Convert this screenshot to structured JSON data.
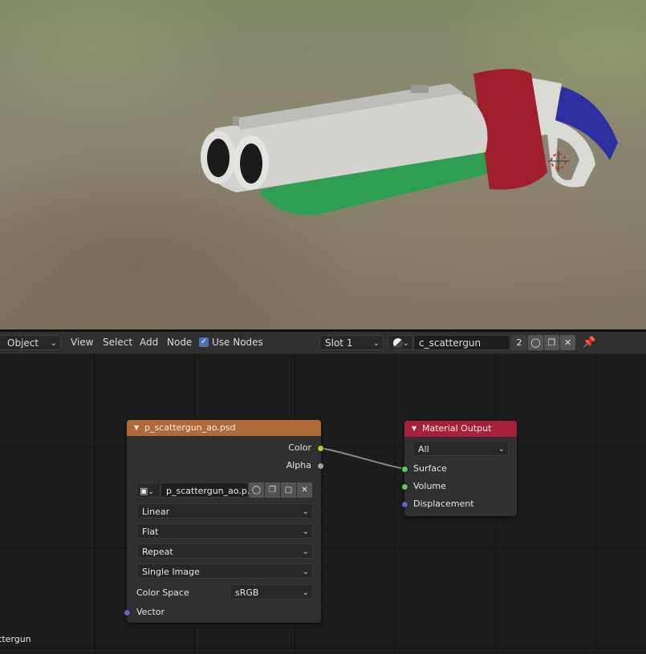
{
  "header": {
    "mode_dropdown": "Object",
    "menus": [
      "View",
      "Select",
      "Add",
      "Node"
    ],
    "use_nodes_label": "Use Nodes",
    "use_nodes_checked": true,
    "slot_dropdown": "Slot 1",
    "material_name": "c_scattergun",
    "user_count": "2"
  },
  "image_node": {
    "title": "p_scattergun_ao.psd",
    "outputs": [
      "Color",
      "Alpha"
    ],
    "image_name": "p_scattergun_ao.p...",
    "interpolation": "Linear",
    "projection": "Flat",
    "extension": "Repeat",
    "source": "Single Image",
    "color_space_label": "Color Space",
    "color_space": "sRGB",
    "input": "Vector"
  },
  "output_node": {
    "title": "Material Output",
    "target": "All",
    "inputs": [
      "Surface",
      "Volume",
      "Displacement"
    ]
  },
  "footer_label": "ttergun",
  "colors": {
    "texture_header": "#b06a3a",
    "output_header": "#a8203a",
    "socket_color": "#c7c729",
    "socket_gray": "#a1a1a1",
    "socket_shader": "#63c763",
    "socket_vector": "#6363c7"
  }
}
